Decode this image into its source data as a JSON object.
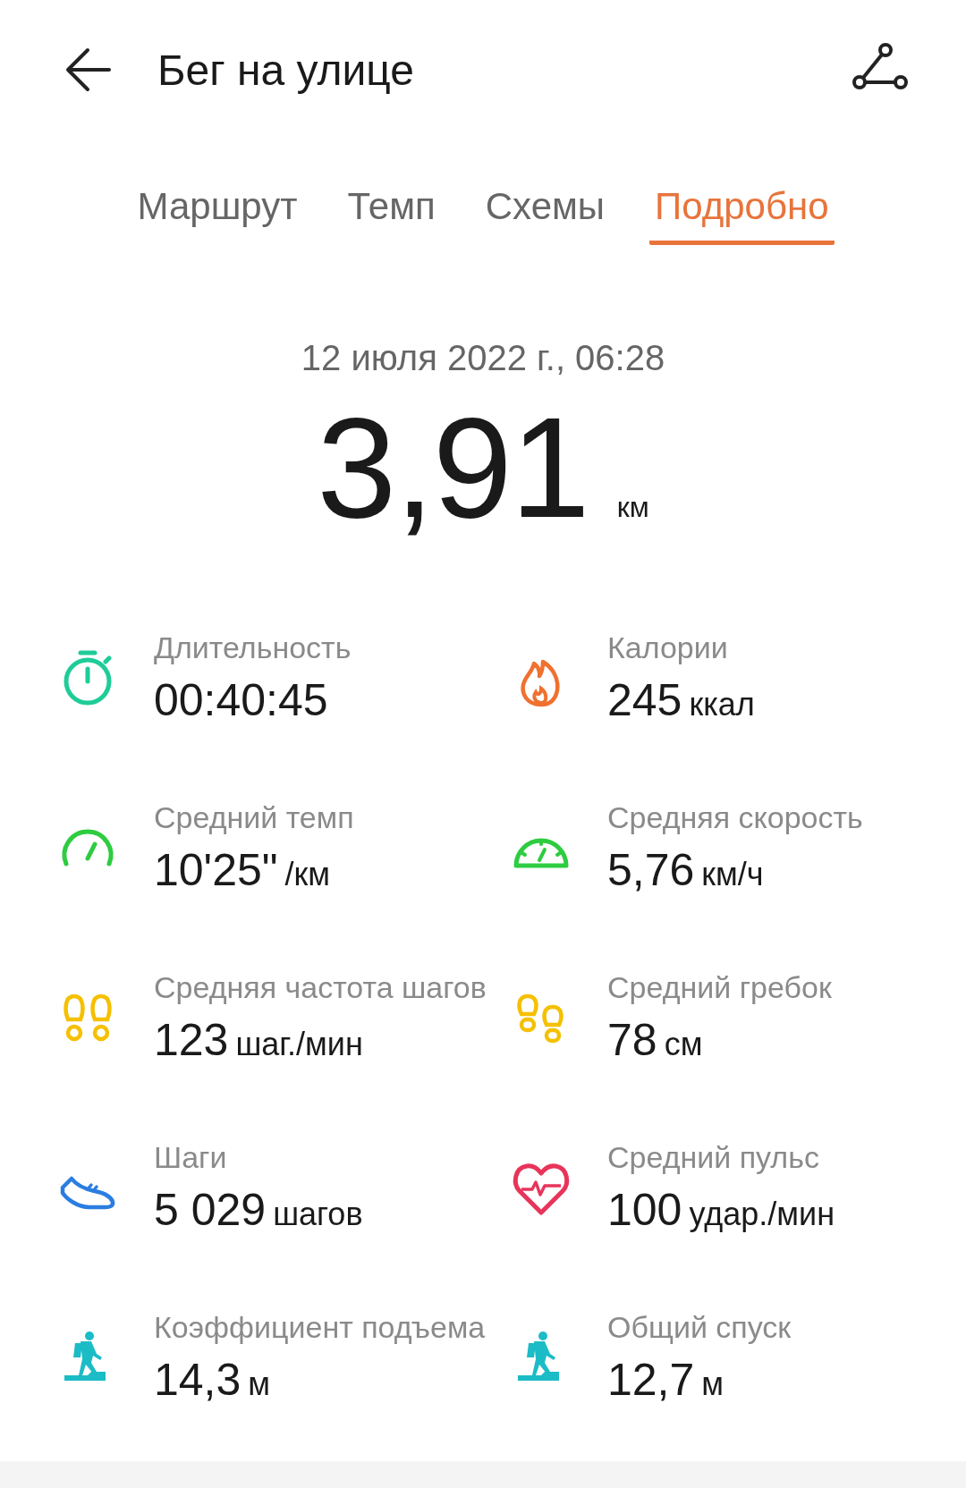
{
  "header": {
    "title": "Бег на улице"
  },
  "tabs": [
    {
      "label": "Маршрут",
      "selected": false
    },
    {
      "label": "Темп",
      "selected": false
    },
    {
      "label": "Схемы",
      "selected": false
    },
    {
      "label": "Подробно",
      "selected": true
    }
  ],
  "summary": {
    "date": "12 июля 2022 г., 06:28",
    "distance": "3,91",
    "unit": "км"
  },
  "stats": [
    {
      "label": "Длительность",
      "value": "00:40:45"
    },
    {
      "label": "Калории",
      "value": "245",
      "unit": "ккал"
    },
    {
      "label": "Средний темп",
      "value": "10'25\"",
      "unit": "/км"
    },
    {
      "label": "Средняя скорость",
      "value": "5,76",
      "unit": "км/ч"
    },
    {
      "label": "Средняя частота шагов",
      "value": "123",
      "unit": "шаг./мин"
    },
    {
      "label": "Средний гребок",
      "value": "78",
      "unit": "см"
    },
    {
      "label": "Шаги",
      "value": "5 029",
      "unit": "шагов"
    },
    {
      "label": "Средний пульс",
      "value": "100",
      "unit": "удар./мин"
    },
    {
      "label": "Коэффициент подъема",
      "value": "14,3",
      "unit": "м"
    },
    {
      "label": "Общий спуск",
      "value": "12,7",
      "unit": "м"
    }
  ]
}
